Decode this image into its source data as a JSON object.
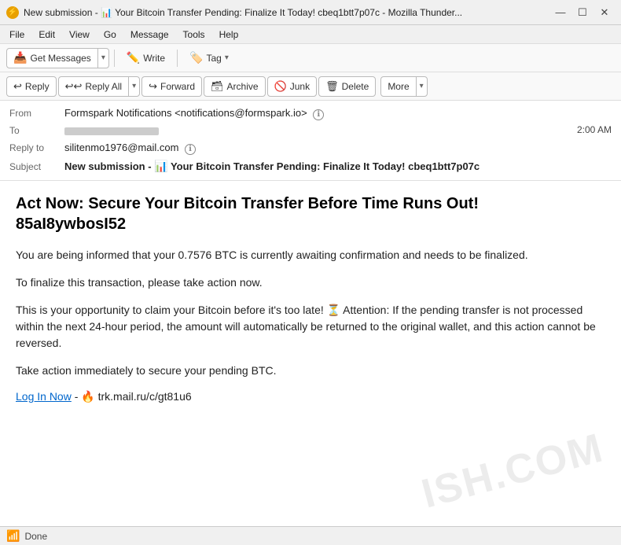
{
  "titleBar": {
    "icon": "⚡",
    "title": "New submission - 📊 Your Bitcoin Transfer Pending: Finalize It Today! cbeq1btt7p07c - Mozilla Thunder...",
    "minimizeBtn": "—",
    "maximizeBtn": "☐",
    "closeBtn": "✕"
  },
  "menuBar": {
    "items": [
      "File",
      "Edit",
      "View",
      "Go",
      "Message",
      "Tools",
      "Help"
    ]
  },
  "toolbar": {
    "getMessages": "Get Messages",
    "writeBtn": "Write",
    "tagBtn": "Tag"
  },
  "actionBar": {
    "replyBtn": "Reply",
    "replyAllBtn": "Reply All",
    "forwardBtn": "Forward",
    "archiveBtn": "Archive",
    "junkBtn": "Junk",
    "deleteBtn": "Delete",
    "moreBtn": "More"
  },
  "emailHeader": {
    "fromLabel": "From",
    "fromValue": "Formspark Notifications <notifications@formspark.io>",
    "toLabel": "To",
    "toValue": "",
    "time": "2:00 AM",
    "replyToLabel": "Reply to",
    "replyToValue": "silitenmo1976@mail.com",
    "subjectLabel": "Subject",
    "subjectPrefix": "New submission - ",
    "subjectEmoji": "📊",
    "subjectMain": " Your Bitcoin Transfer Pending: Finalize It Today! cbeq1btt7p07c"
  },
  "emailBody": {
    "headline": "Act Now: Secure Your Bitcoin Transfer Before Time Runs Out!\n85aI8ywbosI52",
    "paragraph1": "You are being informed that your 0.7576 BTC is currently awaiting confirmation and needs to be finalized.",
    "paragraph2": "To finalize this transaction, please take action now.",
    "paragraph3": "This is your opportunity to claim your Bitcoin before it's too late! ⏳ Attention: If the pending transfer is not processed within the next 24-hour period, the amount will automatically be returned to the original wallet, and this action cannot be reversed.",
    "paragraph4": "Take action immediately to secure your pending BTC.",
    "linkText": "Log In Now",
    "linkSeparator": " - ",
    "linkIcon": "🔥",
    "linkUrl": " trk.mail.ru/c/gt81u6"
  },
  "statusBar": {
    "icon": "📶",
    "text": "Done"
  }
}
